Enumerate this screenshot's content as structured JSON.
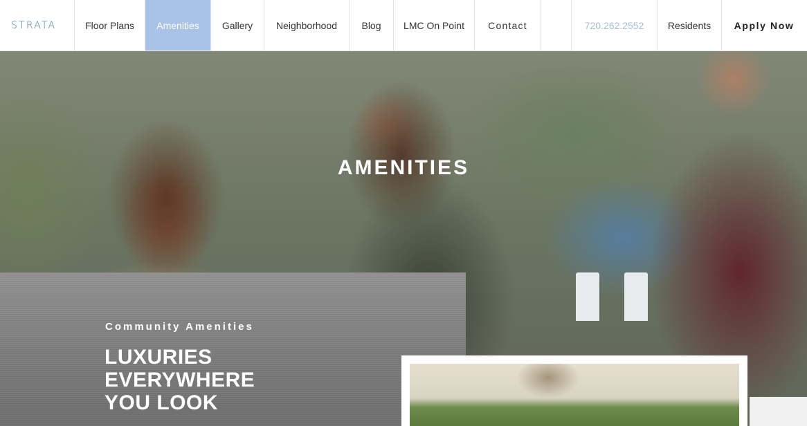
{
  "nav": {
    "logo": "STRATA",
    "items": [
      {
        "label": "Floor Plans"
      },
      {
        "label": "Amenities",
        "active": true
      },
      {
        "label": "Gallery"
      },
      {
        "label": "Neighborhood"
      },
      {
        "label": "Blog"
      },
      {
        "label": "LMC On Point"
      },
      {
        "label": "Contact"
      }
    ],
    "phone": "720.262.2552",
    "residents": "Residents",
    "apply": "Apply Now"
  },
  "hero": {
    "title": "AMENITIES"
  },
  "panel": {
    "eyebrow": "Community Amenities",
    "heading_lines": [
      "LUXURIES",
      "EVERYWHERE",
      "YOU LOOK"
    ]
  },
  "colors": {
    "logo": "#3c7f97",
    "active_nav_bg": "#a9c3e6",
    "phone": "#a8bed8",
    "panel_gray": "#7a7a7a"
  }
}
